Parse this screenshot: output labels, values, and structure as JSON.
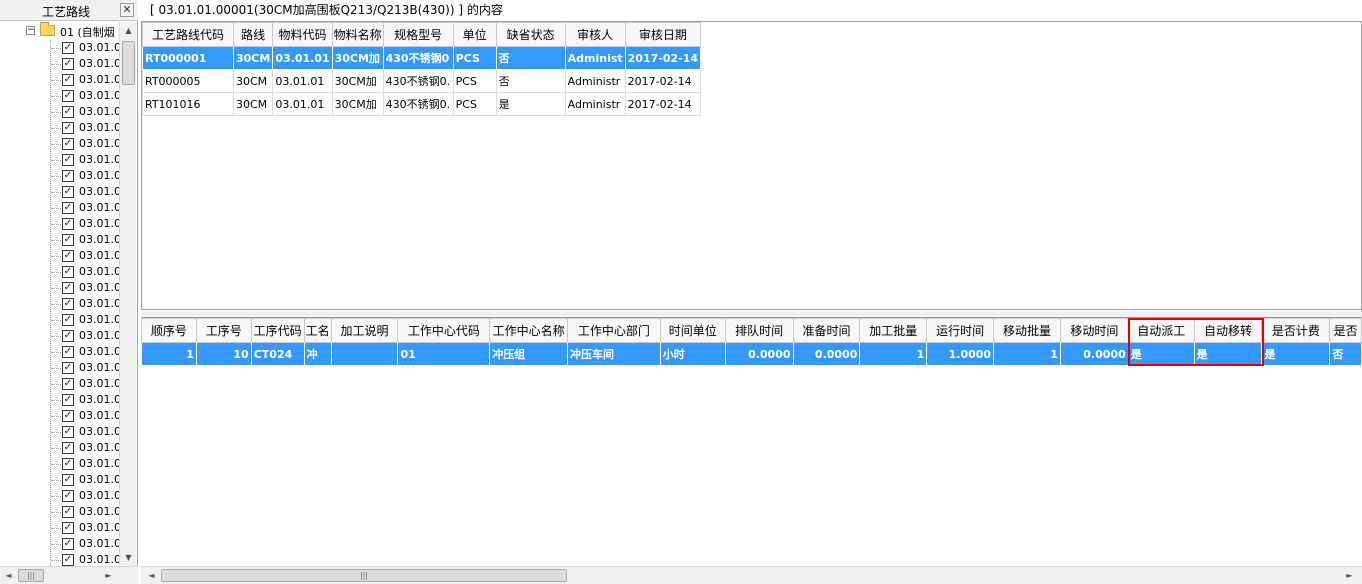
{
  "left_panel": {
    "title": "工艺路线",
    "close_glyph": "✕",
    "tree_root_toggle": "−",
    "tree_root_label": "01 (自制烟",
    "tree_item_label": "03.01.0",
    "tree_item_count": 33
  },
  "caption": "[ 03.01.01.00001(30CM加高围板Q213/Q213B(430)) ]  的内容",
  "top_table": {
    "columns": [
      "工艺路线代码",
      "路线",
      "物料代码",
      "物料名称",
      "规格型号",
      "单位",
      "缺省状态",
      "审核人",
      "审核日期"
    ],
    "rows": [
      [
        "RT000001",
        "30CM",
        "03.01.01",
        "30CM加",
        "430不锈钢0",
        "PCS",
        "否",
        "Administ",
        "2017-02-14"
      ],
      [
        "RT000005",
        "30CM",
        "03.01.01",
        "30CM加",
        "430不锈钢0.",
        "PCS",
        "否",
        "Administr",
        "2017-02-14"
      ],
      [
        "RT101016",
        "30CM",
        "03.01.01",
        "30CM加",
        "430不锈钢0.",
        "PCS",
        "是",
        "Administr",
        "2017-02-14"
      ]
    ]
  },
  "bottom_table": {
    "columns": [
      "顺序号",
      "工序号",
      "工序代码",
      "工名",
      "加工说明",
      "工作中心代码",
      "工作中心名称",
      "工作中心部门",
      "时间单位",
      "排队时间",
      "准备时间",
      "加工批量",
      "运行时间",
      "移动批量",
      "移动时间",
      "自动派工",
      "自动移转",
      "是否计费",
      "是否"
    ],
    "rows": [
      [
        "1",
        "10",
        "CT024",
        "冲",
        "",
        "01",
        "冲压组",
        "冲压车间",
        "小时",
        "0.0000",
        "0.0000",
        "1",
        "1.0000",
        "1",
        "0.0000",
        "是",
        "是",
        "是",
        "否"
      ]
    ]
  },
  "scroll": {
    "up": "▲",
    "down": "▼",
    "left": "◄",
    "right": "►",
    "grip": "|||"
  },
  "colors": {
    "selection": "#3399ff",
    "highlight_box": "#e00000"
  }
}
